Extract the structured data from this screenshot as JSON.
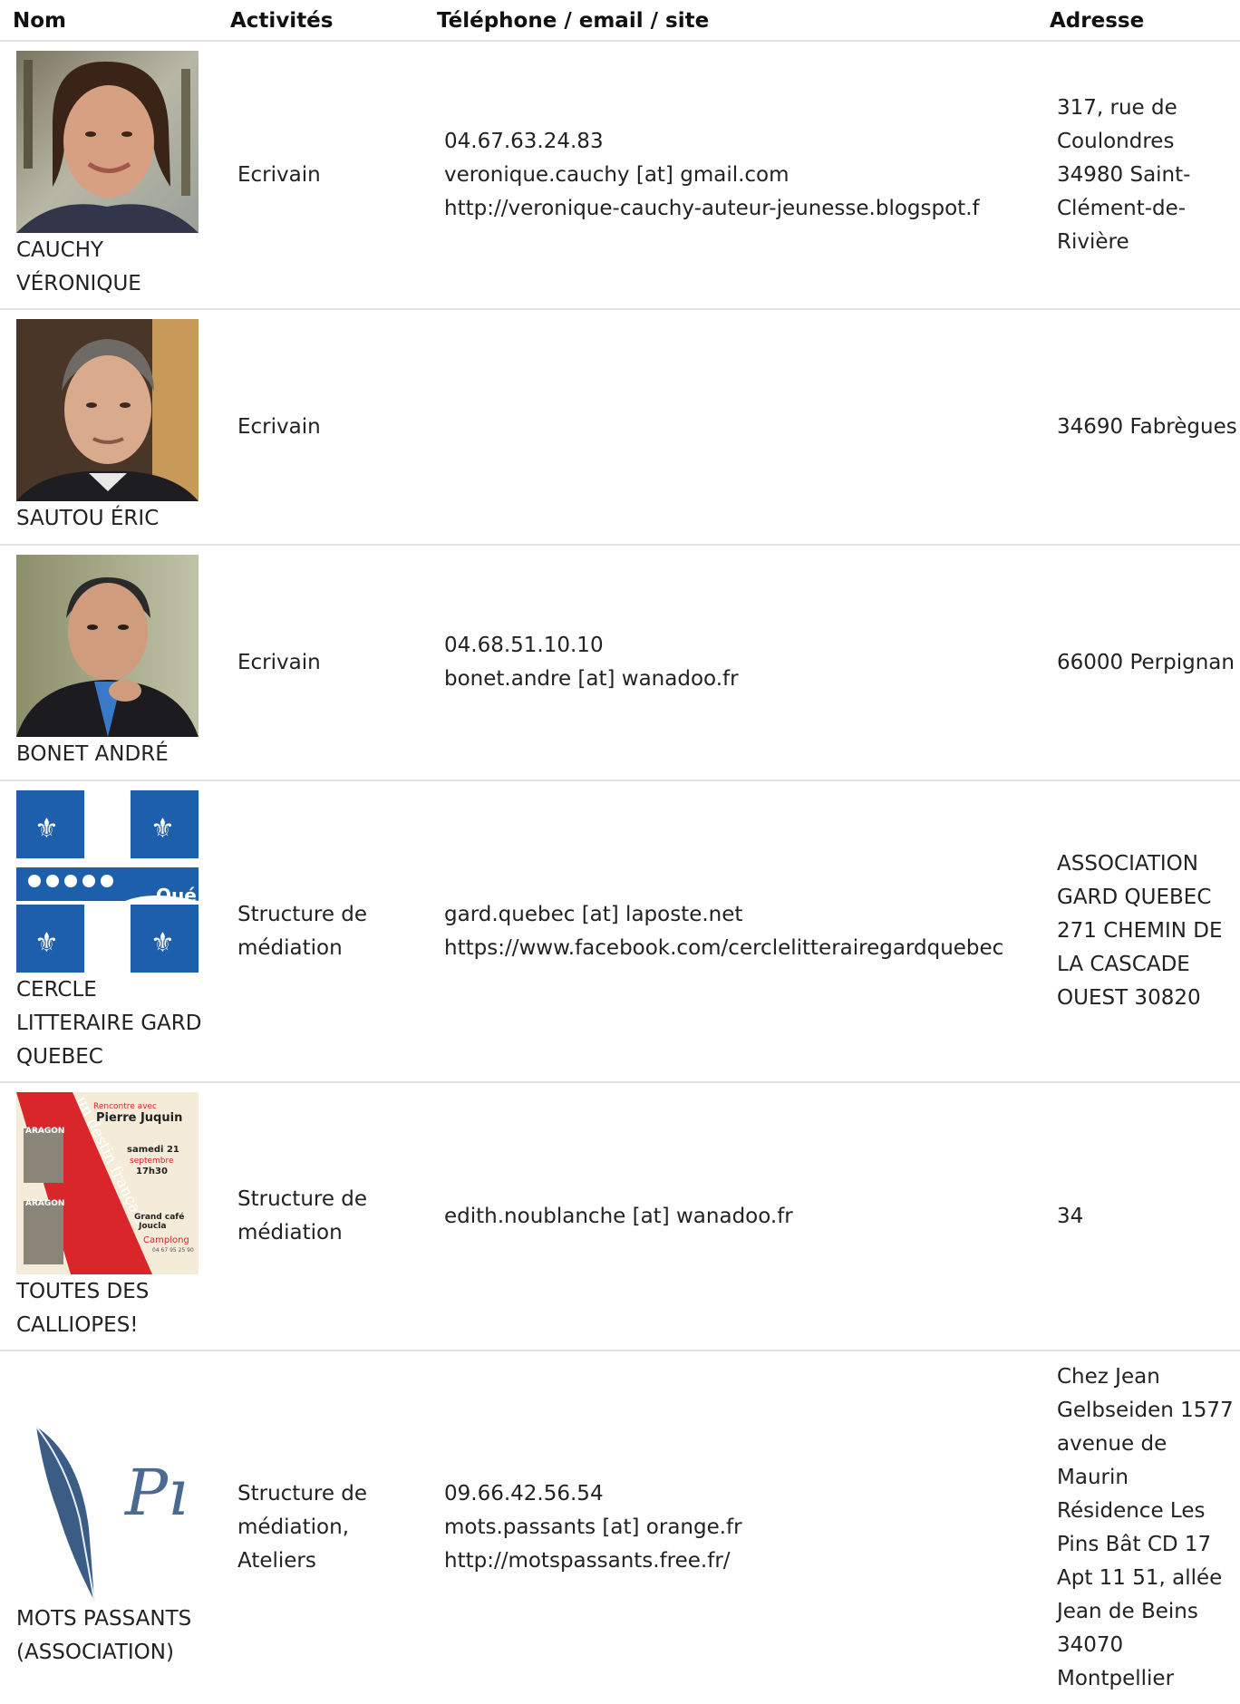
{
  "columns": {
    "name": "Nom",
    "activities": "Activités",
    "contact": "Téléphone / email / site",
    "address": "Adresse"
  },
  "entries": [
    {
      "name": "CAUCHY VÉRONIQUE",
      "activities": "Ecrivain",
      "phone": "04.67.63.24.83",
      "email": "veronique.cauchy [at] gmail.com",
      "site": "http://veronique-cauchy-auteur-jeunesse.blogspot.f",
      "address": "317, rue de Coulondres 34980 Saint-Clément-de-Rivière"
    },
    {
      "name": "SAUTOU ÉRIC",
      "activities": "Ecrivain",
      "address": "34690 Fabrègues"
    },
    {
      "name": "BONET ANDRÉ",
      "activities": "Ecrivain",
      "phone": "04.68.51.10.10",
      "email": "bonet.andre [at] wanadoo.fr",
      "address": "66000 Perpignan"
    },
    {
      "name": "CERCLE LITTERAIRE GARD QUEBEC",
      "activities": "Structure de médiation",
      "email": "gard.quebec [at] laposte.net",
      "site": "https://www.facebook.com/cerclelitterairegardquebec",
      "address": "ASSOCIATION GARD QUEBEC 271 CHEMIN DE LA CASCADE OUEST 30820",
      "image_text": "Qué"
    },
    {
      "name": "TOUTES DES CALLIOPES!",
      "activities": "Structure de médiation",
      "email": "edith.noublanche [at] wanadoo.fr",
      "address": "34",
      "poster": {
        "invite": "Rencontre avec",
        "guest": "Pierre Juquin",
        "book": "ARAGON",
        "vertical_title": "un destin français",
        "date": "samedi 21",
        "month": "septembre",
        "time": "17h30",
        "venue": "Grand café",
        "venue2": "Joucla",
        "town": "Camplong",
        "phone": "04 67 95 25 90"
      }
    },
    {
      "name": "MOTS PASSANTS (ASSOCIATION)",
      "activities": "Structure de médiation, Ateliers",
      "phone": "09.66.42.56.54",
      "email": "mots.passants [at] orange.fr",
      "site": "http://motspassants.free.fr/",
      "address": "Chez Jean Gelbseiden 1577 avenue de Maurin Résidence Les Pins Bât CD 17 Apt 11 51, allée Jean de Beins 34070 Montpellier",
      "logo_text": "Pı"
    }
  ],
  "colors": {
    "quebec_blue": "#1d5faa",
    "poster_red": "#d8262b",
    "poster_bg": "#f4ecd8",
    "row_border": "#e3e3e3"
  }
}
